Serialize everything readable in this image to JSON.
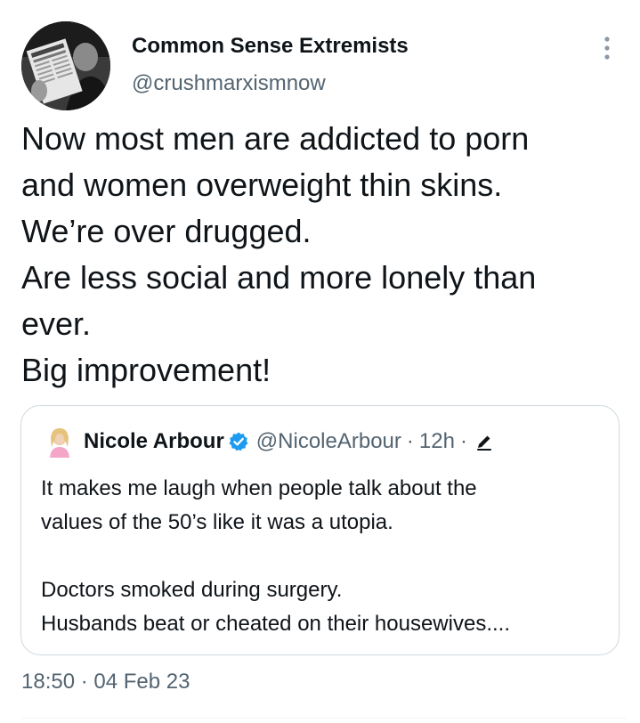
{
  "tweet": {
    "author_name": "Common Sense Extremists",
    "author_handle": "@crushmarxismnow",
    "text_lines": [
      "Now most men are addicted to porn",
      "and women overweight thin skins.",
      "We’re over drugged.",
      "Are less social and more lonely than",
      "ever.",
      "Big improvement!"
    ],
    "time": "18:50",
    "separator": "·",
    "date": "04 Feb 23",
    "more_icon": "more-options-icon"
  },
  "quote": {
    "name": "Nicole Arbour",
    "verified_icon": "verified-badge-icon",
    "handle": "@NicoleArbour",
    "separator": "·",
    "age": "12h",
    "edited_icon": "edit-pencil-icon",
    "text_lines": [
      "It makes me laugh when people talk about the",
      "values of the 50’s like it was a utopia.",
      "",
      "Doctors smoked during surgery.",
      "Husbands beat or cheated on their housewives...."
    ]
  },
  "colors": {
    "text_primary": "#0f1419",
    "text_secondary": "#536471",
    "verified_blue": "#1d9bf0",
    "border": "#cfd9de"
  }
}
